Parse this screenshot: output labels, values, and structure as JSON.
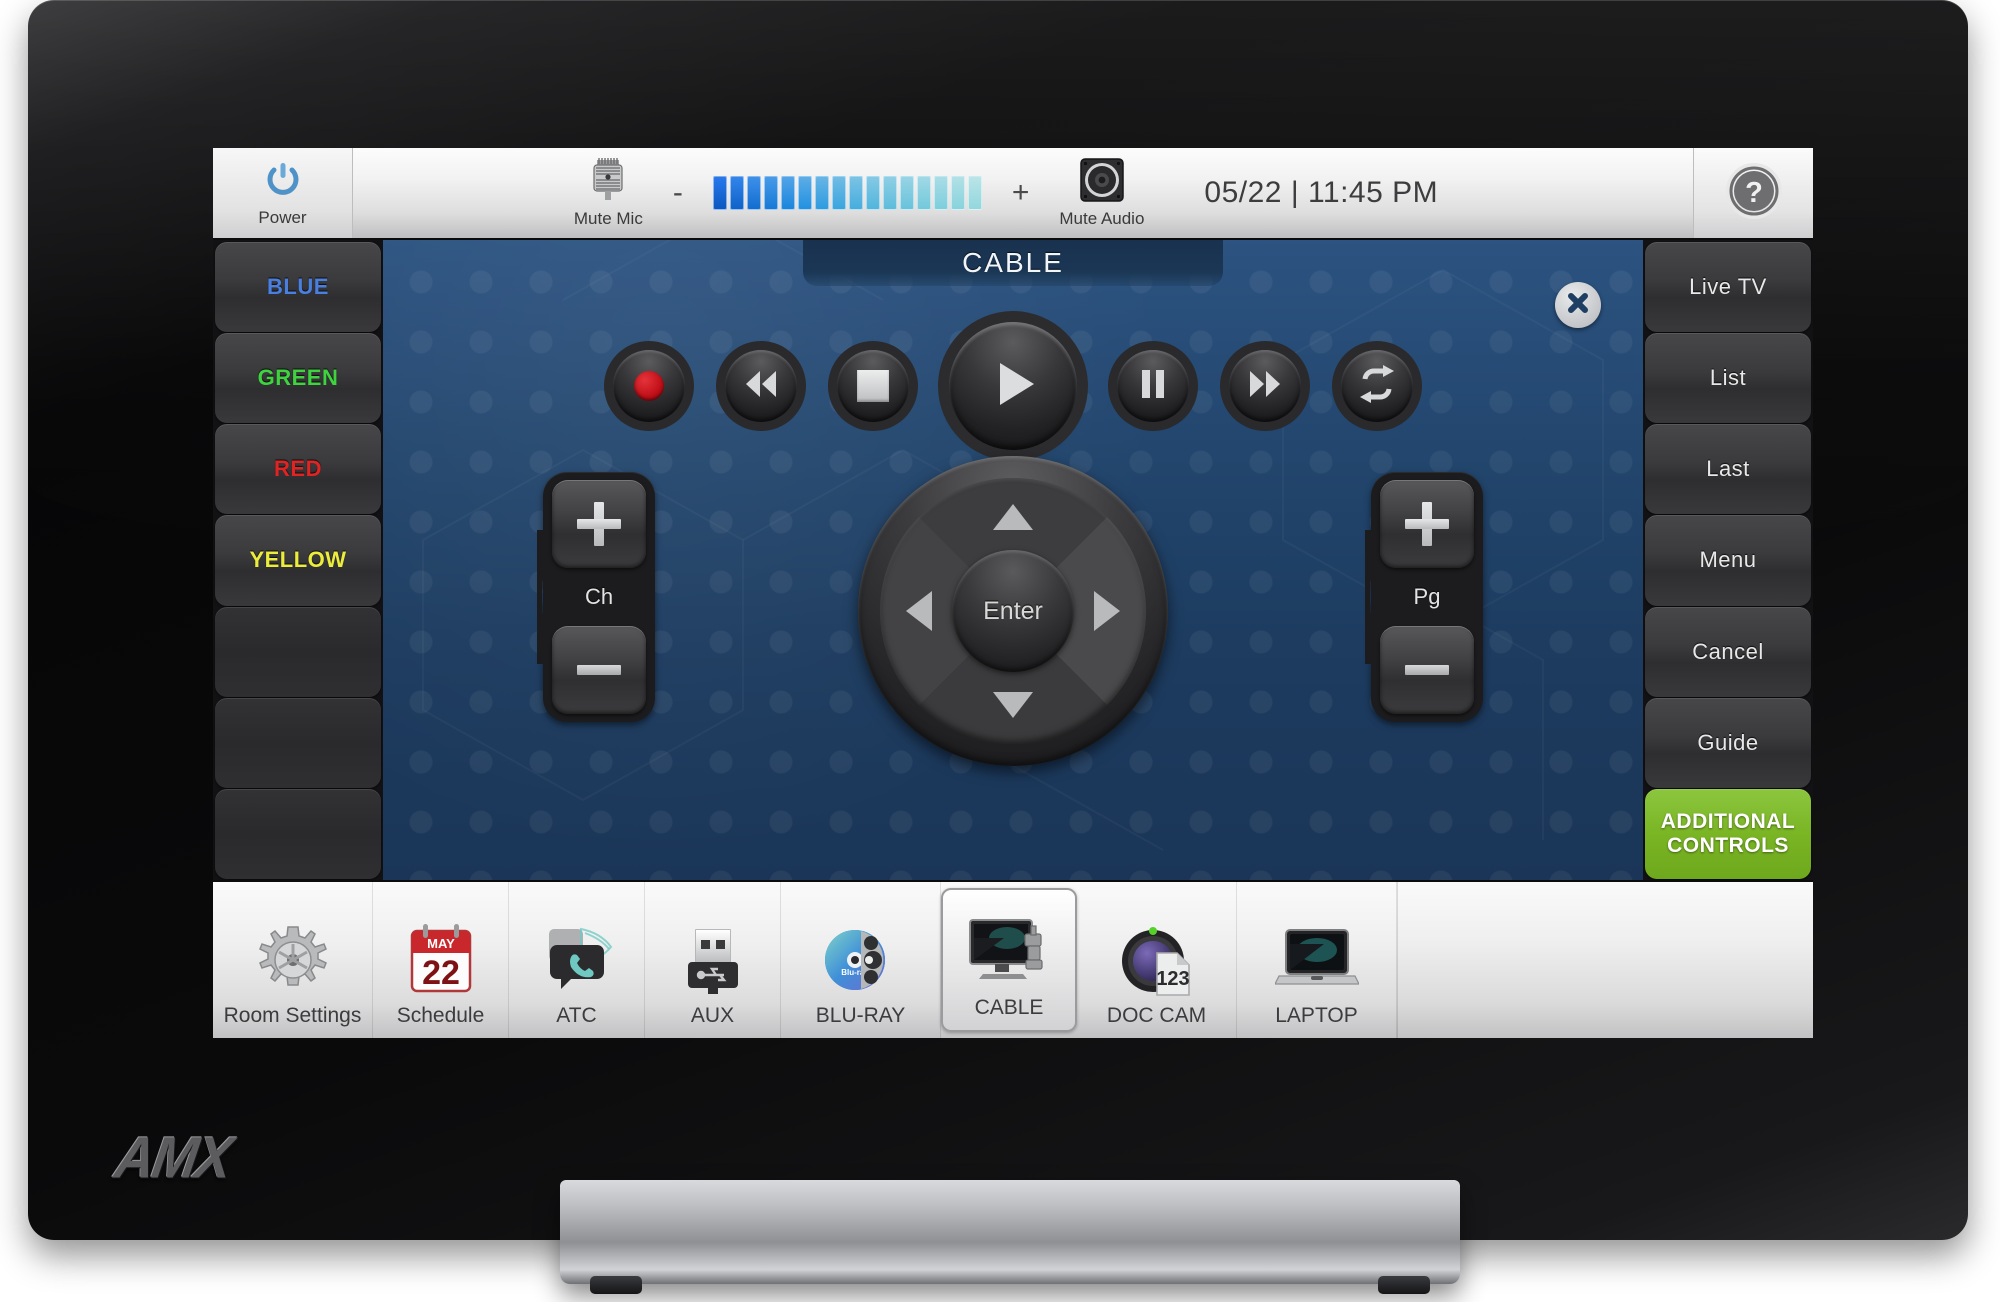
{
  "device": {
    "brand": "AMX"
  },
  "topbar": {
    "power": {
      "label": "Power",
      "icon": "power-icon",
      "color": "#4f92c8"
    },
    "mute_mic": {
      "label": "Mute Mic",
      "icon": "microphone-icon"
    },
    "mute_audio": {
      "label": "Mute Audio",
      "icon": "speaker-icon"
    },
    "volume_down": "-",
    "volume_up": "+",
    "volume": {
      "segments": 16,
      "level": 16
    },
    "datetime": "05/22 | 11:45 PM",
    "help": {
      "icon": "question-mark-icon",
      "label": "?"
    }
  },
  "left_sidebar": {
    "items": [
      {
        "label": "BLUE",
        "color": "#4a7fe0"
      },
      {
        "label": "GREEN",
        "color": "#3fd43f"
      },
      {
        "label": "RED",
        "color": "#e02323"
      },
      {
        "label": "YELLOW",
        "color": "#ecec3c"
      },
      {
        "label": "",
        "color": ""
      },
      {
        "label": "",
        "color": ""
      },
      {
        "label": "",
        "color": ""
      }
    ]
  },
  "right_sidebar": {
    "items": [
      {
        "label": "Live TV",
        "style": "normal"
      },
      {
        "label": "List",
        "style": "normal"
      },
      {
        "label": "Last",
        "style": "normal"
      },
      {
        "label": "Menu",
        "style": "normal"
      },
      {
        "label": "Cancel",
        "style": "normal"
      },
      {
        "label": "Guide",
        "style": "normal"
      }
    ],
    "additional_controls": {
      "line1": "ADDITIONAL",
      "line2": "CONTROLS",
      "color": "#7ab524"
    }
  },
  "page": {
    "title": "CABLE",
    "close": "close-icon",
    "transport": [
      {
        "name": "record",
        "icon": "record-icon"
      },
      {
        "name": "rewind",
        "icon": "rewind-icon"
      },
      {
        "name": "stop",
        "icon": "stop-icon"
      },
      {
        "name": "play",
        "icon": "play-icon"
      },
      {
        "name": "pause",
        "icon": "pause-icon"
      },
      {
        "name": "fast-forward",
        "icon": "fast-forward-icon"
      },
      {
        "name": "repeat",
        "icon": "repeat-icon"
      }
    ],
    "channel_rocker": {
      "label": "Ch",
      "up": "+",
      "down": "-"
    },
    "page_rocker": {
      "label": "Pg",
      "up": "+",
      "down": "-"
    },
    "dpad": {
      "center": "Enter",
      "up": "up-arrow",
      "down": "down-arrow",
      "left": "left-arrow",
      "right": "right-arrow"
    }
  },
  "sourcebar": {
    "items": [
      {
        "label": "Room Settings",
        "icon": "gear-icon",
        "selected": false,
        "wide": true
      },
      {
        "label": "Schedule",
        "icon": "calendar-icon",
        "selected": false,
        "wide": false
      },
      {
        "label": "ATC",
        "icon": "phone-icon",
        "selected": false,
        "wide": false
      },
      {
        "label": "AUX",
        "icon": "usb-icon",
        "selected": false,
        "wide": false
      },
      {
        "label": "BLU-RAY",
        "icon": "bluray-disc-icon",
        "selected": false,
        "wide": true
      },
      {
        "label": "CABLE",
        "icon": "tv-icon",
        "selected": true,
        "wide": false
      },
      {
        "label": "DOC CAM",
        "icon": "document-camera-icon",
        "selected": false,
        "wide": true
      },
      {
        "label": "LAPTOP",
        "icon": "laptop-icon",
        "selected": false,
        "wide": true
      }
    ],
    "calendar": {
      "month": "MAY",
      "day": "22"
    },
    "doc_cam_badge": "123"
  }
}
